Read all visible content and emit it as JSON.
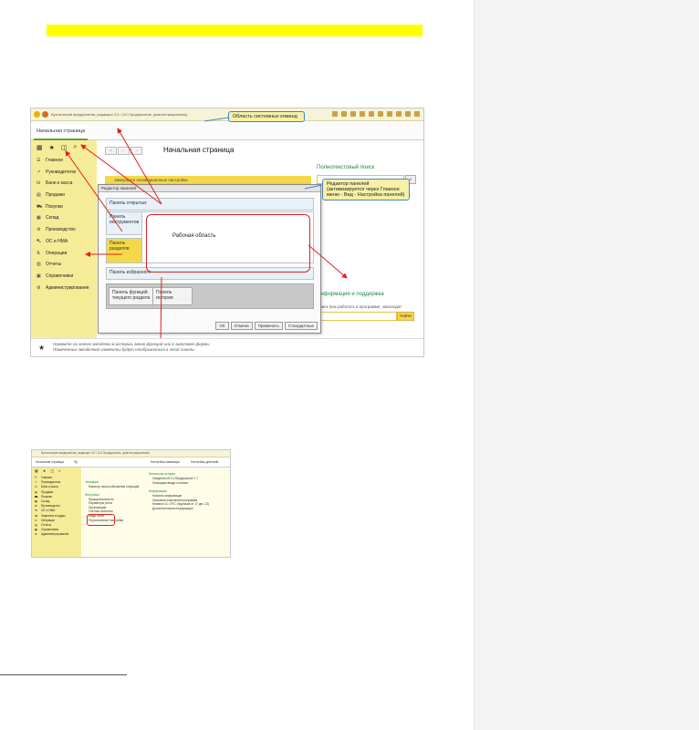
{
  "screenshot1": {
    "window_title": "Бухгалтерия предприятия, редакция 3.0 / (1С:Предприятие, демонстрационная)",
    "home_tab": "Начальная страница",
    "sidebar_icons": [
      "grid-icon",
      "star-icon",
      "history-icon",
      "search-icon"
    ],
    "sidebar_items": [
      {
        "icon": "☰",
        "label": "Главное"
      },
      {
        "icon": "↗",
        "label": "Руководителю"
      },
      {
        "icon": "⛁",
        "label": "Банк и касса"
      },
      {
        "icon": "▤",
        "label": "Продажи"
      },
      {
        "icon": "⛟",
        "label": "Покупки"
      },
      {
        "icon": "▦",
        "label": "Склад"
      },
      {
        "icon": "⚙",
        "label": "Производство"
      },
      {
        "icon": "⛍",
        "label": "ОС и НМА"
      },
      {
        "icon": "⇅",
        "label": "Операции"
      },
      {
        "icon": "▥",
        "label": "Отчеты"
      },
      {
        "icon": "▣",
        "label": "Справочники"
      },
      {
        "icon": "⚙",
        "label": "Администрирование"
      }
    ],
    "page_title": "Начальная страница",
    "notice_text": "Завершите незавершенные настройки",
    "fulltext_search_title": "Полнотекстовый поиск",
    "info_title": "Информация и поддержка",
    "info_hint": "Поиск (как работать в программе, законодат",
    "info_button": "Найти",
    "footer_line1": "Нажмите на значок звездочки в истории, меню функций или в заголовке формы",
    "footer_line2": "Помеченные звездочкой элементы будут отображаться в этой панели.",
    "dialog": {
      "title": "Редактор панелей",
      "panel_open": "Панель открытых",
      "panel_tools": "Панель инструментов",
      "panel_sections": "Панель разделов",
      "work_area": "Рабочая область",
      "panel_favorites": "Панель избранного",
      "panel_functions": "Панель функций текущего раздела",
      "panel_history": "Панель истории",
      "buttons": [
        "ОК",
        "Отмена",
        "Применить",
        "Стандартные"
      ]
    },
    "callout_system": "Область системных команд",
    "callout_editor": "Редактор панелей (активизируется через Главное меню - Вид - Настройка панелей)"
  },
  "screenshot2": {
    "window_title": "Бухгалтерия предприятия, редакция 3.0 / (1С:Предприятие, демонстрационная)",
    "tabs": [
      "Начальная страница",
      "Пр",
      "Настройка навигации",
      "Настройка действий"
    ],
    "sidebar_items": [
      {
        "icon": "☰",
        "label": "Главное"
      },
      {
        "icon": "↗",
        "label": "Руководителю"
      },
      {
        "icon": "⛁",
        "label": "Банк и касса"
      },
      {
        "icon": "▤",
        "label": "Продажи"
      },
      {
        "icon": "⛟",
        "label": "Покупки"
      },
      {
        "icon": "▦",
        "label": "Склад"
      },
      {
        "icon": "⚙",
        "label": "Производство"
      },
      {
        "icon": "⛍",
        "label": "ОС и НМА"
      },
      {
        "icon": "☻",
        "label": "Зарплата и кадры"
      },
      {
        "icon": "⇅",
        "label": "Операции"
      },
      {
        "icon": "▥",
        "label": "Отчеты"
      },
      {
        "icon": "▣",
        "label": "Справочники"
      },
      {
        "icon": "⚙",
        "label": "Администрирование"
      }
    ],
    "col1": {
      "sec1": "Операции",
      "sec1_items": [
        "Монитор налогообложения операций"
      ],
      "sec2": "Настройки",
      "sec2_items": [
        "Функциональность",
        "Параметры учета",
        "Организации",
        "Учетная политика",
        "Виды оплат",
        "Персональные настройки"
      ]
    },
    "col2": {
      "sec1": "Начальная история",
      "sec1_items": [
        "Сведения об 1С:Предприятие 7.7",
        "Помощник ввода остатков"
      ],
      "sec2": "Информация",
      "sec2_items": [
        "Новости информации",
        "Описание изменений программы",
        "Новинки 1С: ИТС (подписка от 17 дек. 13)",
        "Дополнительная информация"
      ]
    }
  }
}
